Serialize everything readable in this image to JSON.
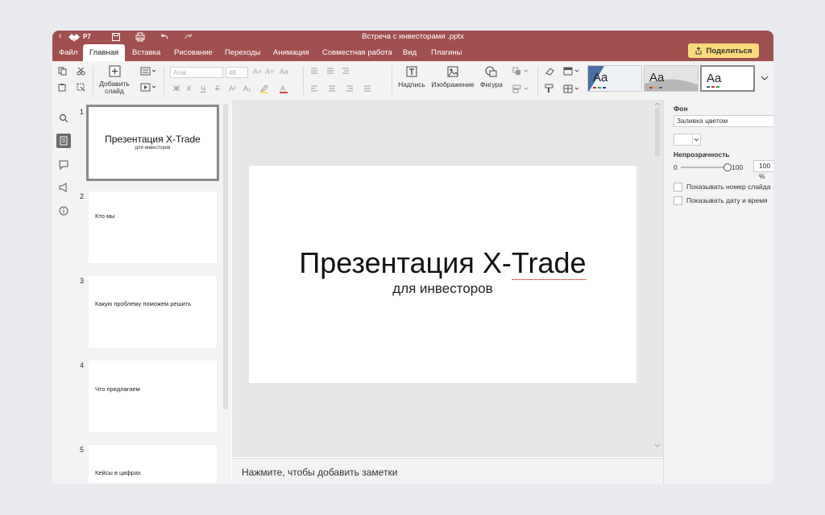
{
  "titlebar": {
    "brand": "Р7",
    "doc_title": "Встреча с инвесторами .pptx"
  },
  "menu": {
    "tabs": [
      "Файл",
      "Главная",
      "Вставка",
      "Рисование",
      "Переходы",
      "Анимация",
      "Совместная работа",
      "Вид",
      "Плагины"
    ],
    "active_tab": "Главная",
    "share_label": "Поделиться"
  },
  "toolbar": {
    "add_slide_label": "Добавить\nслайд",
    "font_name": "Arial",
    "font_size": "48",
    "caption_label": "Надпись",
    "image_label": "Изображение",
    "shape_label": "Фигура",
    "bold": "Ж",
    "italic": "К",
    "underline": "Ч",
    "strike": "Т",
    "superscript": "A²",
    "subscript": "A₂",
    "aa_case": "Aa",
    "themes": [
      "Aa",
      "Aa",
      "Aa"
    ]
  },
  "slides": [
    {
      "num": "1",
      "title": "Презентация X-Trade",
      "subtitle": "для инвесторов"
    },
    {
      "num": "2",
      "text": "Кто мы"
    },
    {
      "num": "3",
      "text": "Какую проблему поможем решить"
    },
    {
      "num": "4",
      "text": "Что предлагаем"
    },
    {
      "num": "5",
      "text": "Кейсы в цифрах"
    }
  ],
  "main_slide": {
    "title_part1": "Презентация X-",
    "title_part2": "Trade",
    "subtitle": "для инвесторов"
  },
  "notes_placeholder": "Нажмите, чтобы добавить заметки",
  "right_panel": {
    "background_header": "Фон",
    "fill_type": "Заливка цветом",
    "opacity_header": "Непрозрачность",
    "opacity_min": "0",
    "opacity_max": "100",
    "opacity_value": "100 %",
    "opacity_level": 100,
    "show_slide_number": "Показывать номер слайда",
    "show_date_time": "Показывать дату и время"
  },
  "colors": {
    "accent": "#a0504f",
    "share_button": "#fcd97a"
  }
}
